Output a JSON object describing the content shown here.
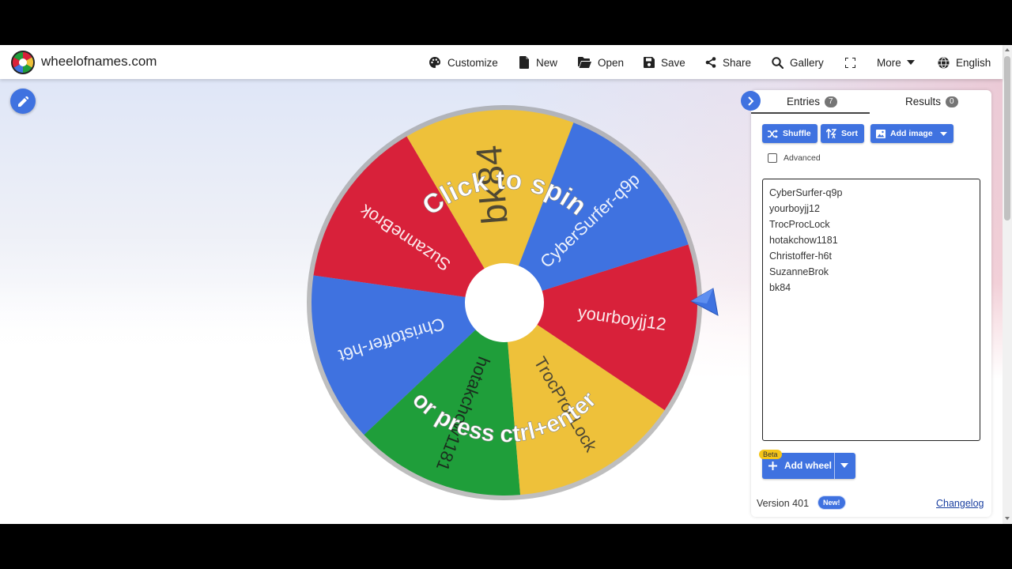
{
  "app": {
    "site_name": "wheelofnames.com"
  },
  "nav": {
    "customize": "Customize",
    "new": "New",
    "open": "Open",
    "save": "Save",
    "share": "Share",
    "gallery": "Gallery",
    "more": "More",
    "language": "English"
  },
  "wheel": {
    "prompt_top": "Click to spin",
    "prompt_bottom": "or press ctrl+enter",
    "segments": [
      {
        "label": "bk84",
        "color": "#eec13a"
      },
      {
        "label": "SuzanneBrok",
        "color": "#d8213a"
      },
      {
        "label": "Christoffer-h6t",
        "color": "#3f72e0"
      },
      {
        "label": "hotakchow1181",
        "color": "#1f9e3a"
      },
      {
        "label": "TrocProcLock",
        "color": "#eec13a"
      },
      {
        "label": "yourboyjj12",
        "color": "#d8213a"
      },
      {
        "label": "CyberSurfer-q9p",
        "color": "#3f72e0"
      }
    ]
  },
  "panel": {
    "tab_entries": "Entries",
    "entries_count": "7",
    "tab_results": "Results",
    "results_count": "0",
    "shuffle": "Shuffle",
    "sort": "Sort",
    "add_image": "Add image",
    "advanced": "Advanced",
    "entries": [
      "CyberSurfer-q9p",
      "yourboyjj12",
      "TrocProcLock",
      "hotakchow1181",
      "Christoffer-h6t",
      "SuzanneBrok",
      "bk84"
    ],
    "beta": "Beta",
    "add_wheel": "Add wheel",
    "version": "Version 401",
    "new_badge": "New!",
    "changelog": "Changelog"
  },
  "colors": {
    "accent": "#3f72e0",
    "yellow": "#eec13a",
    "red": "#d8213a",
    "blue": "#3f72e0",
    "green": "#1f9e3a"
  }
}
